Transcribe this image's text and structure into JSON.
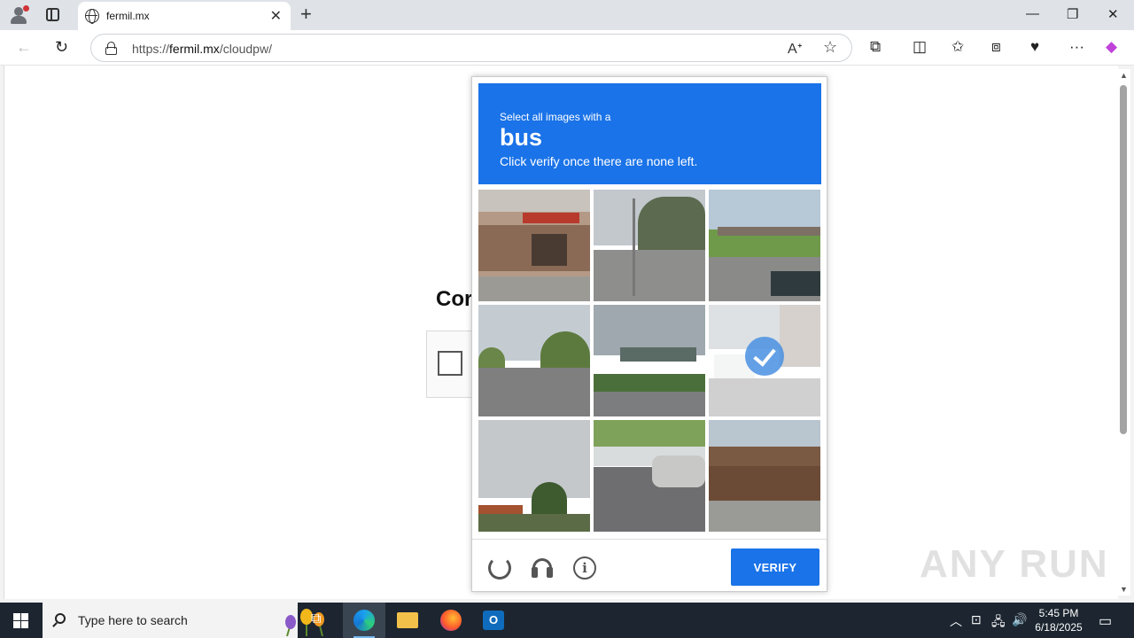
{
  "browser": {
    "tab_title": "fermil.mx",
    "url_prefix": "https://",
    "url_domain": "fermil.mx",
    "url_path": "/cloudpw/"
  },
  "page": {
    "heading": "Cor"
  },
  "captcha": {
    "instruction_line1": "Select all images with a",
    "target": "bus",
    "instruction_line2": "Click verify once there are none left.",
    "verify_label": "VERIFY",
    "selected_tile": 6,
    "header_color": "#1a73e8"
  },
  "watermark": "ANY RUN",
  "taskbar": {
    "search_placeholder": "Type here to search",
    "time": "5:45 PM",
    "date": "6/18/2025"
  }
}
